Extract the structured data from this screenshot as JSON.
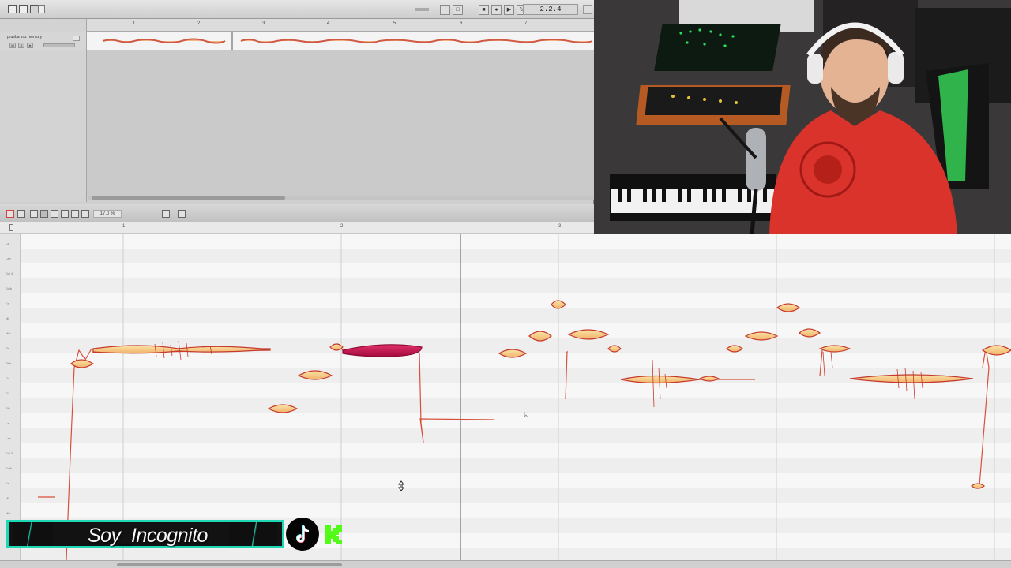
{
  "arrange": {
    "position_display": "2.2.4",
    "track_name": "prueba voz mercury",
    "track_buttons": [
      "M",
      "S",
      "●"
    ],
    "ruler_marks": [
      "1",
      "2",
      "3",
      "4",
      "5",
      "6",
      "7"
    ]
  },
  "editor": {
    "zoom_value": "17.0 %",
    "bar_numbers": [
      "1",
      "2",
      "3"
    ],
    "pitch_labels": [
      "La",
      "Lab",
      "Sol 4",
      "Solb",
      "Fa",
      "Mi",
      "Mib",
      "Re",
      "Reb",
      "Do",
      "Si",
      "Sib",
      "La",
      "Lab",
      "Sol 3",
      "Solb",
      "Fa",
      "Mi",
      "Mib"
    ]
  },
  "overlay": {
    "streamer_name": "Soy_Incognito",
    "social_icons": [
      "tiktok-icon",
      "kick-icon"
    ],
    "accent_color": "#1ed7b5",
    "kick_color": "#53fc18"
  },
  "colors": {
    "blob_fill": "#f7c77e",
    "blob_stroke": "#c53a2c",
    "blob_selected": "#c8104a",
    "pitch_line": "#d8503c"
  }
}
